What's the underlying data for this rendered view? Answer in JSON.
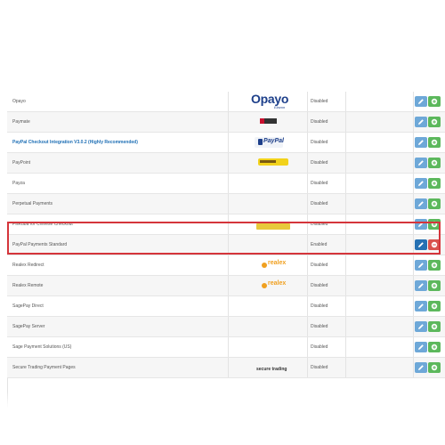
{
  "rows": [
    {
      "name": "Opayo",
      "status": "Disabled",
      "logo": "opayo",
      "logo_text": "Opayo",
      "logo_sub": "Elavon",
      "is_link": false
    },
    {
      "name": "Paymate",
      "status": "Disabled",
      "logo": "paymate",
      "is_link": false
    },
    {
      "name": "PayPal Checkout Integration V3.0.2 (Highly Recommended)",
      "status": "Disabled",
      "logo": "paypal",
      "logo_text": "PayPal",
      "is_link": true
    },
    {
      "name": "PayPoint",
      "status": "Disabled",
      "logo": "paypoint",
      "is_link": false
    },
    {
      "name": "Payza",
      "status": "Disabled",
      "logo": "",
      "is_link": false
    },
    {
      "name": "Perpetual Payments",
      "status": "Disabled",
      "logo": "",
      "is_link": false
    },
    {
      "name": "PiliKuba for Chinese Checkout",
      "status": "Disabled",
      "logo": "yellowbar",
      "is_link": false
    },
    {
      "name": "PayPal Payments Standard",
      "status": "Enabled",
      "logo": "",
      "is_link": false,
      "highlight": true
    },
    {
      "name": "Realex Redirect",
      "status": "Disabled",
      "logo": "realex",
      "logo_text": "realex",
      "is_link": false
    },
    {
      "name": "Realex Remote",
      "status": "Disabled",
      "logo": "realex",
      "logo_text": "realex",
      "is_link": false
    },
    {
      "name": "SagePay Direct",
      "status": "Disabled",
      "logo": "",
      "is_link": false
    },
    {
      "name": "SagePay Server",
      "status": "Disabled",
      "logo": "",
      "is_link": false
    },
    {
      "name": "Sage Payment Solutions (US)",
      "status": "Disabled",
      "logo": "",
      "is_link": false
    },
    {
      "name": "Secure Trading Payment Pages",
      "status": "Disabled",
      "logo": "securetrading",
      "logo_text": "secure trading",
      "is_link": false
    }
  ],
  "icons": {
    "edit": "pencil-icon",
    "install": "plus-circle-icon",
    "uninstall": "minus-circle-icon"
  },
  "colors": {
    "edit": "#6ea8d8",
    "edit_active": "#2671b3",
    "install": "#5cb85c",
    "uninstall": "#d9534f",
    "highlight": "#d5353b",
    "link": "#1e6fb5"
  }
}
